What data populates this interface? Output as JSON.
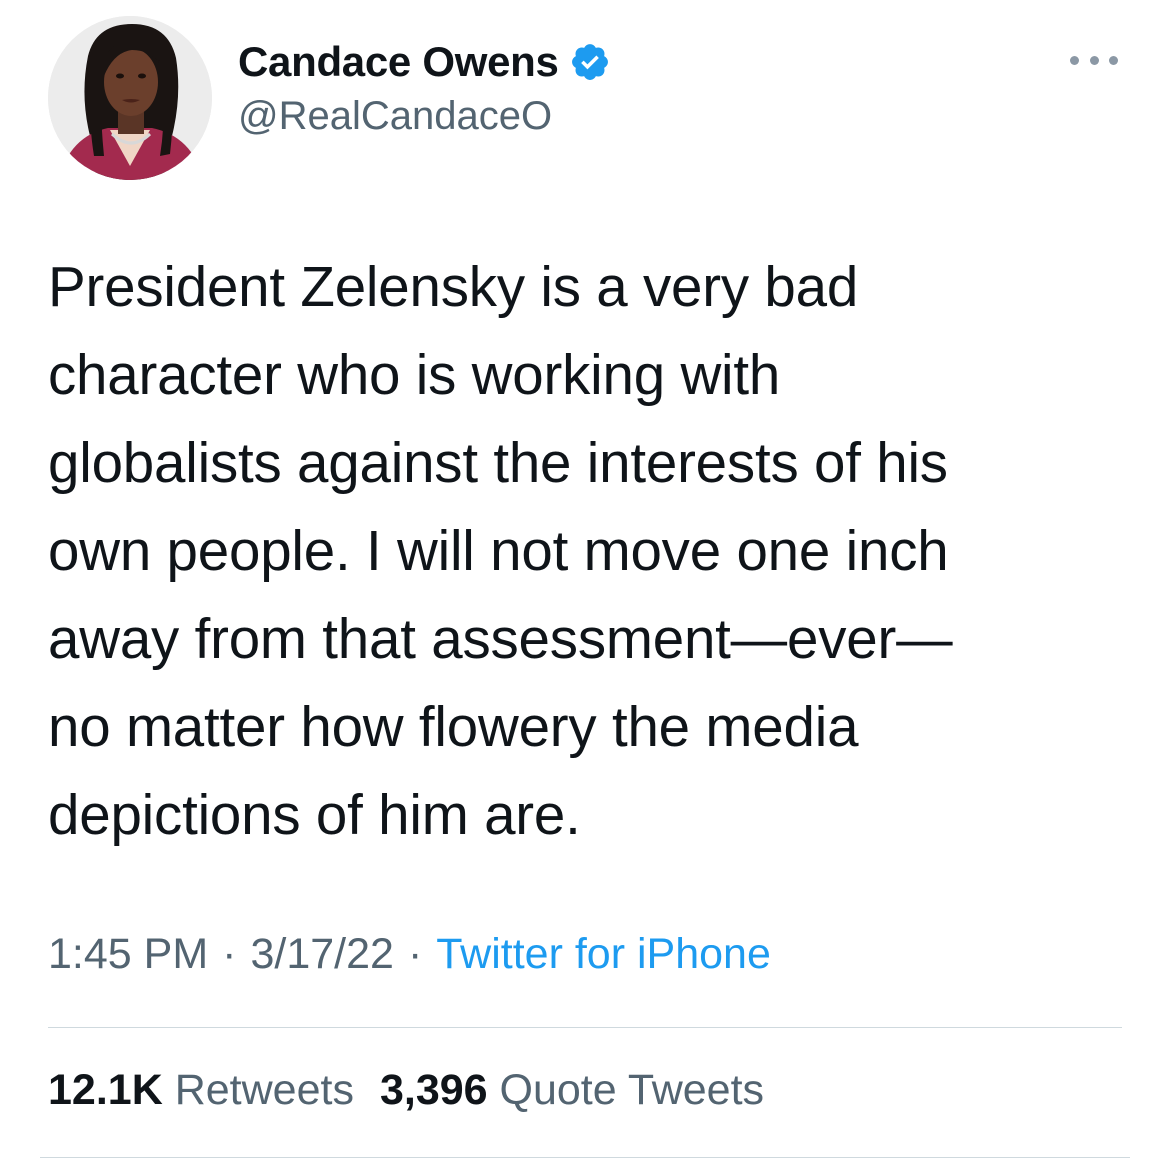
{
  "author": {
    "display_name": "Candace Owens",
    "handle": "@RealCandaceO",
    "verified": true,
    "verified_color": "#1d9bf0"
  },
  "more_icon": "more-horizontal-icon",
  "tweet": {
    "lines": [
      "President Zelensky is a very bad",
      "character who is working with",
      "globalists against the interests of his",
      "own people. I will not move one inch",
      "away from that assessment—ever—",
      "no matter how flowery the media",
      "depictions of him are."
    ]
  },
  "meta": {
    "time": "1:45 PM",
    "date": "3/17/22",
    "separator": "·",
    "source": "Twitter for iPhone"
  },
  "stats": {
    "retweets_count": "12.1K",
    "retweets_label": "Retweets",
    "quotes_count": "3,396",
    "quotes_label": "Quote Tweets"
  },
  "colors": {
    "text": "#0f1419",
    "secondary": "#536471",
    "link": "#1d9bf0",
    "divider": "#cfd9de"
  }
}
